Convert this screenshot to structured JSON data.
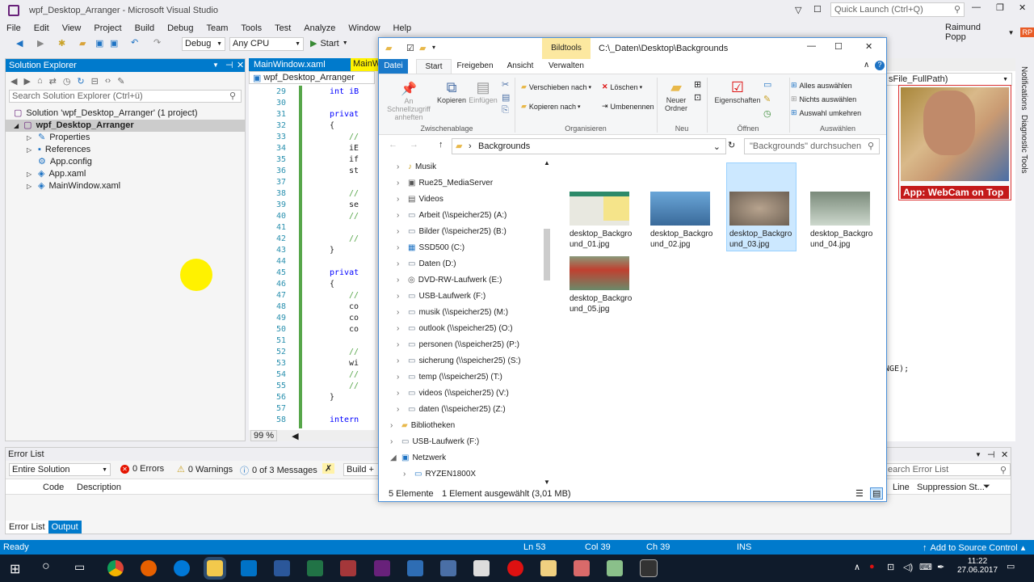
{
  "vs": {
    "title": "wpf_Desktop_Arranger - Microsoft Visual Studio",
    "quick_launch": "Quick Launch (Ctrl+Q)",
    "user": "Raimund Popp",
    "initials": "RP",
    "menu": [
      "File",
      "Edit",
      "View",
      "Project",
      "Build",
      "Debug",
      "Team",
      "Tools",
      "Test",
      "Analyze",
      "Window",
      "Help"
    ],
    "config": "Debug",
    "platform": "Any CPU",
    "start": "Start"
  },
  "solution": {
    "title": "Solution Explorer",
    "search": "Search Solution Explorer (Ctrl+ü)",
    "root": "Solution 'wpf_Desktop_Arranger' (1 project)",
    "project": "wpf_Desktop_Arranger",
    "items": [
      "Properties",
      "References",
      "App.config",
      "App.xaml",
      "MainWindow.xaml"
    ]
  },
  "editor": {
    "tab": "MainWindow.xaml",
    "tab2": "MainW",
    "nav": "wpf_Desktop_Arranger",
    "zoom": "99 %",
    "lines": [
      "29",
      "30",
      "31",
      "32",
      "33",
      "34",
      "35",
      "36",
      "37",
      "38",
      "39",
      "40",
      "41",
      "42",
      "43",
      "44",
      "45",
      "46",
      "47",
      "48",
      "49",
      "50",
      "51",
      "52",
      "53",
      "54",
      "55",
      "56",
      "57",
      "58"
    ],
    "code": [
      "int iB",
      "",
      "privat",
      "{",
      "//",
      "iE",
      "if",
      "st",
      "",
      "//",
      "se",
      "//",
      "",
      "//",
      "}",
      "",
      "privat",
      "{",
      "//",
      "co",
      "co",
      "co",
      "",
      "//",
      "wi",
      "//",
      "//",
      "}",
      "",
      "intern"
    ],
    "right_nav": "sFile_FullPath)",
    "right_code": "NGE);"
  },
  "webcam_label": "App: WebCam on Top",
  "errors": {
    "title": "Error List",
    "scope": "Entire Solution",
    "errors": "0 Errors",
    "warnings": "0 Warnings",
    "messages": "0 of 3 Messages",
    "build": "Build + In",
    "search": "earch Error List",
    "cols": [
      "Code",
      "Description",
      "Line",
      "Suppression St..."
    ],
    "tabs": [
      "Error List",
      "Output"
    ]
  },
  "status": {
    "ready": "Ready",
    "ln": "Ln 53",
    "col": "Col 39",
    "ch": "Ch 39",
    "ins": "INS",
    "source": "Add to Source Control"
  },
  "clock": {
    "time": "11:22",
    "date": "27.06.2017"
  },
  "explorer": {
    "context_tab": "Bildtools",
    "path_title": "C:\\_Daten\\Desktop\\Backgrounds",
    "tabs": [
      "Datei",
      "Start",
      "Freigeben",
      "Ansicht",
      "Verwalten"
    ],
    "ribbon": {
      "pin": "An Schnellzugriff anheften",
      "copy": "Kopieren",
      "paste": "Einfügen",
      "moveto": "Verschieben nach",
      "copyto": "Kopieren nach",
      "delete": "Löschen",
      "rename": "Umbenennen",
      "newfolder": "Neuer Ordner",
      "props": "Eigenschaften",
      "selall": "Alles auswählen",
      "selnone": "Nichts auswählen",
      "invert": "Auswahl umkehren",
      "groups": [
        "Zwischenablage",
        "Organisieren",
        "Neu",
        "Öffnen",
        "Auswählen"
      ]
    },
    "address": "Backgrounds",
    "search": "\"Backgrounds\" durchsuchen",
    "nav": [
      "Musik",
      "Rue25_MediaServer",
      "Videos",
      "Arbeit (\\\\speicher25) (A:)",
      "Bilder (\\\\speicher25) (B:)",
      "SSD500 (C:)",
      "Daten (D:)",
      "DVD-RW-Laufwerk (E:)",
      "USB-Laufwerk (F:)",
      "musik (\\\\speicher25) (M:)",
      "outlook (\\\\speicher25) (O:)",
      "personen (\\\\speicher25) (P:)",
      "sicherung (\\\\speicher25) (S:)",
      "temp (\\\\speicher25) (T:)",
      "videos (\\\\speicher25) (V:)",
      "daten (\\\\speicher25) (Z:)",
      "Bibliotheken",
      "USB-Laufwerk (F:)",
      "Netzwerk",
      "RYZEN1800X"
    ],
    "files": [
      "desktop_Backgro und_01.jpg",
      "desktop_Backgro und_02.jpg",
      "desktop_Backgro und_03.jpg",
      "desktop_Backgro und_04.jpg",
      "desktop_Backgro und_05.jpg"
    ],
    "count": "5 Elemente",
    "selected": "1 Element ausgewählt (3,01 MB)"
  },
  "side_tabs": [
    "Notifications",
    "Diagnostic Tools"
  ],
  "colors": {
    "accent": "#007acc",
    "highlight": "#cce8ff",
    "yellow": "#fff200"
  }
}
